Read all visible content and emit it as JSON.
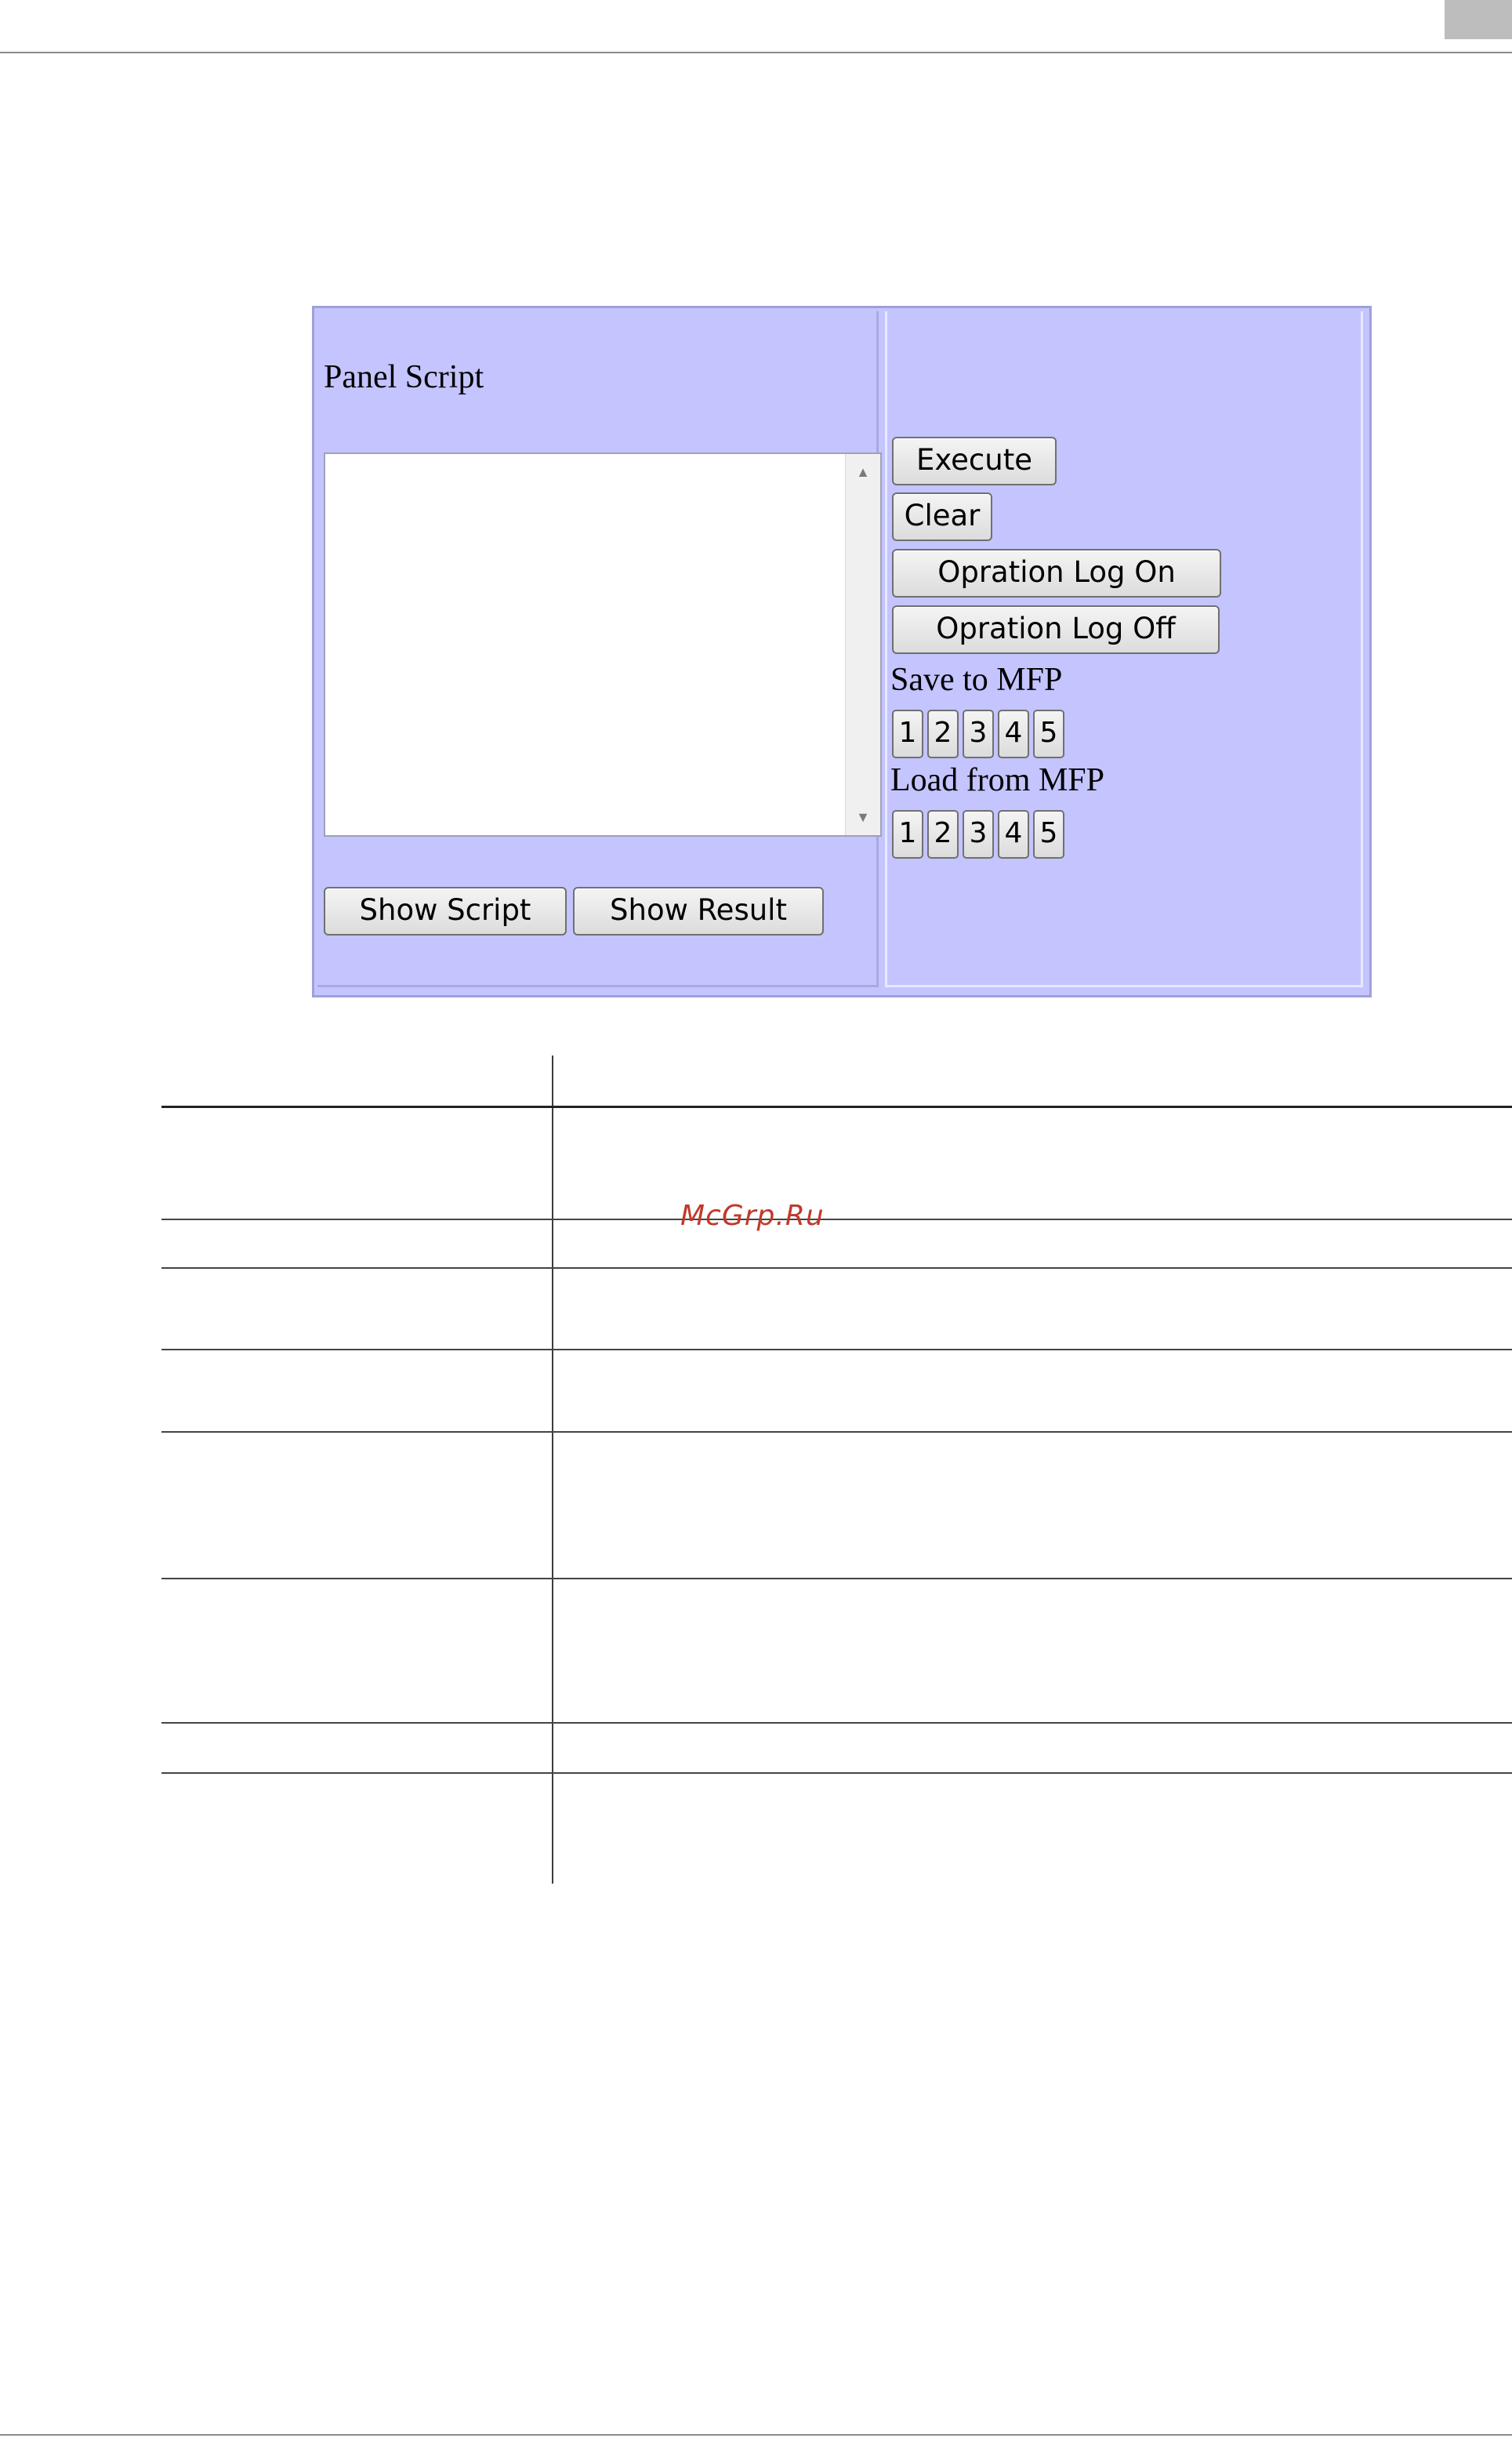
{
  "panel": {
    "title": "Panel Script",
    "script_text": "",
    "buttons": {
      "show_script": "Show Script",
      "show_result": "Show Result",
      "execute": "Execute",
      "clear": "Clear",
      "log_on": "Opration Log On",
      "log_off": "Opration Log Off"
    },
    "save_label": "Save to MFP",
    "load_label": "Load from MFP",
    "save_slots": [
      "1",
      "2",
      "3",
      "4",
      "5"
    ],
    "load_slots": [
      "1",
      "2",
      "3",
      "4",
      "5"
    ]
  },
  "watermark": {
    "text": "McGrp.Ru",
    "color": "#c0392b"
  },
  "colors": {
    "panel_background": "#c4c4ff",
    "text_area_background": "#ffffff"
  }
}
